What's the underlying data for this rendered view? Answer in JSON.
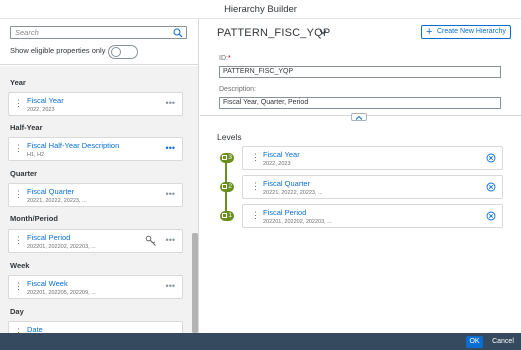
{
  "dialog": {
    "title": "Hierarchy Builder"
  },
  "left_panel": {
    "search": {
      "placeholder": "Search",
      "value": ""
    },
    "eligible_toggle": {
      "label": "Show eligible properties only",
      "on": false
    },
    "groups": [
      {
        "label": "Year",
        "items": [
          {
            "name": "Fiscal Year",
            "sub": "2022, 2023"
          }
        ]
      },
      {
        "label": "Half-Year",
        "items": [
          {
            "name": "Fiscal Half-Year Description",
            "sub": "H1, H2"
          }
        ]
      },
      {
        "label": "Quarter",
        "items": [
          {
            "name": "Fiscal Quarter",
            "sub": "20221, 20222, 20223, ..."
          }
        ]
      },
      {
        "label": "Month/Period",
        "items": [
          {
            "name": "Fiscal Period",
            "sub": "202201, 202202, 202203, ..."
          }
        ]
      },
      {
        "label": "Week",
        "items": [
          {
            "name": "Fiscal Week",
            "sub": "202201, 202205, 202209, ..."
          }
        ]
      },
      {
        "label": "Day",
        "items": [
          {
            "name": "Date",
            "sub": ""
          }
        ]
      }
    ]
  },
  "right_panel": {
    "hierarchy_name": "PATTERN_FISC_YQP",
    "create_button": "Create New Hierarchy",
    "id_label": "ID:",
    "id_required_mark": "*",
    "id_value": "PATTERN_FISC_YQP",
    "description_label": "Description:",
    "description_value": "Fiscal Year, Quarter, Period",
    "levels_title": "Levels",
    "levels": [
      {
        "badge": "3",
        "name": "Fiscal Year",
        "sub": "2022, 2023"
      },
      {
        "badge": "2",
        "name": "Fiscal Quarter",
        "sub": "20221, 20222, 20223, ..."
      },
      {
        "badge": "1",
        "name": "Fiscal Period",
        "sub": "202201, 202202, 202203, ..."
      }
    ]
  },
  "footer": {
    "ok_label": "OK",
    "cancel_label": "Cancel"
  },
  "colors": {
    "accent": "#0a6ed1",
    "level_badge": "#6a8f1f",
    "footer_bg": "#354a5f",
    "required": "#bb0000"
  }
}
